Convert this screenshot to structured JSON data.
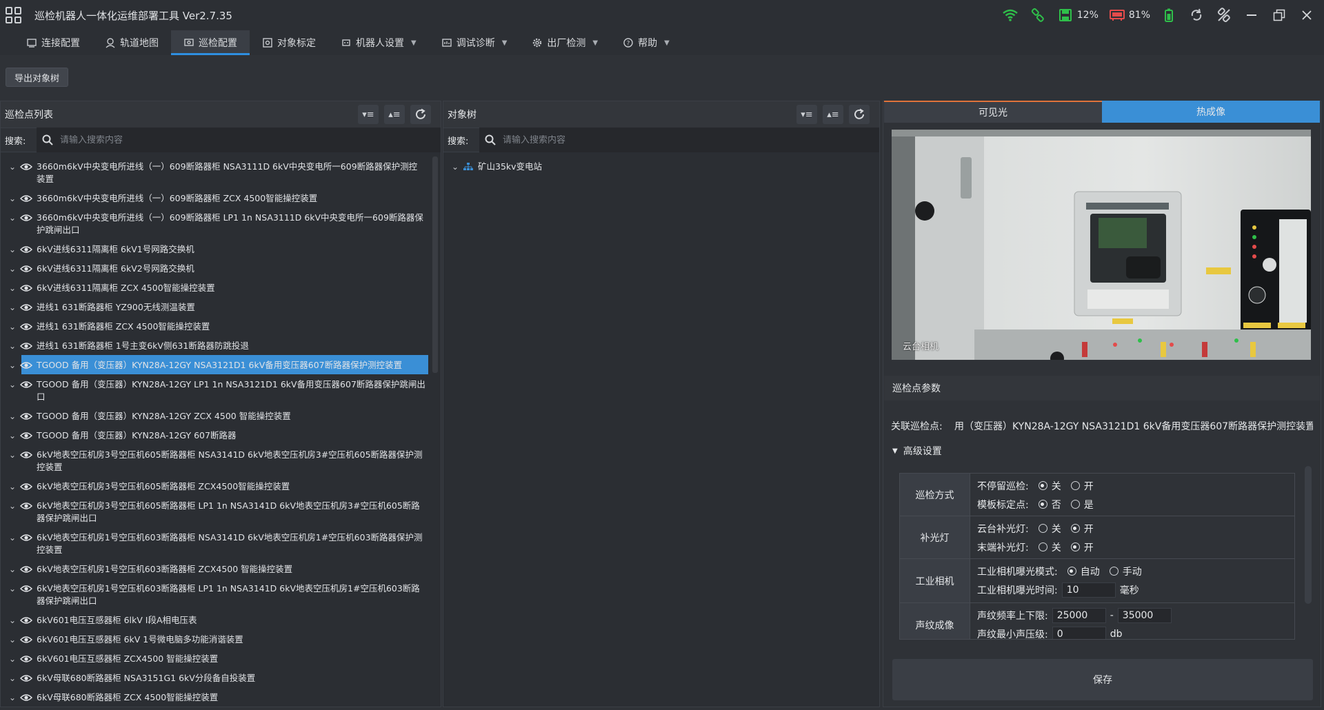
{
  "app": {
    "title": "巡检机器人一体化运维部署工具 Ver2.7.35",
    "wifi_pct": "12%",
    "battery_pct": "81%"
  },
  "menu": [
    {
      "label": "连接配置",
      "icon": "link-icon",
      "dropdown": false
    },
    {
      "label": "轨道地图",
      "icon": "map-icon",
      "dropdown": false
    },
    {
      "label": "巡检配置",
      "icon": "inspection-icon",
      "dropdown": false,
      "active": true
    },
    {
      "label": "对象标定",
      "icon": "target-icon",
      "dropdown": false
    },
    {
      "label": "机器人设置",
      "icon": "robot-icon",
      "dropdown": true
    },
    {
      "label": "调试诊断",
      "icon": "debug-icon",
      "dropdown": true
    },
    {
      "label": "出厂检测",
      "icon": "gear-icon",
      "dropdown": true
    },
    {
      "label": "帮助",
      "icon": "help-icon",
      "dropdown": true
    }
  ],
  "toolbar": {
    "export_label": "导出对象树"
  },
  "left_panel": {
    "title": "巡检点列表",
    "search_label": "搜索:",
    "search_placeholder": "请输入搜索内容",
    "items": [
      "3660m6kV中央变电所进线（一）609断路器柜 NSA3111D 6kV中央变电所一609断路器保护测控装置",
      "3660m6kV中央变电所进线（一）609断路器柜 ZCX 4500智能操控装置",
      "3660m6kV中央变电所进线（一）609断路器柜 LP1 1n NSA3111D 6kV中央变电所一609断路器保护跳闸出口",
      "6kV进线6311隔离柜 6kV1号网路交换机",
      "6kV进线6311隔离柜 6kV2号网路交换机",
      "6kV进线6311隔离柜 ZCX 4500智能操控装置",
      "进线1 631断路器柜 YZ900无线测温装置",
      "进线1 631断路器柜 ZCX 4500智能操控装置",
      "进线1 631断路器柜 1号主变6kV侧631断路器防跳投退",
      "TGOOD 备用（变压器）KYN28A-12GY NSA3121D1 6kV备用变压器607断路器保护测控装置",
      "TGOOD 备用（变压器）KYN28A-12GY LP1 1n NSA3121D1 6kV备用变压器607断路器保护跳闸出口",
      "TGOOD 备用（变压器）KYN28A-12GY ZCX 4500 智能操控装置",
      "TGOOD 备用（变压器）KYN28A-12GY 607断路器",
      "6kV地表空压机房3号空压机605断路器柜 NSA3141D 6kV地表空压机房3#空压机605断路器保护测控装置",
      "6kV地表空压机房3号空压机605断路器柜 ZCX4500智能操控装置",
      "6kV地表空压机房3号空压机605断路器柜 LP1 1n NSA3141D 6kV地表空压机房3#空压机605断路器保护跳闸出口",
      "6kV地表空压机房1号空压机603断路器柜 NSA3141D 6kV地表空压机房1#空压机603断路器保护测控装置",
      "6kV地表空压机房1号空压机603断路器柜 ZCX4500 智能操控装置",
      "6kV地表空压机房1号空压机603断路器柜 LP1 1n NSA3141D 6kV地表空压机房1#空压机603断路器保护跳闸出口",
      "6kV601电压互感器柜 6lkV I段A相电压表",
      "6kV601电压互感器柜 6kV 1号微电脑多功能消谐装置",
      "6kV601电压互感器柜 ZCX4500 智能操控装置",
      "6kV母联680断路器柜 NSA3151G1 6kV分段备自投装置",
      "6kV母联680断路器柜 ZCX 4500智能操控装置",
      "6kV母联680断路器柜 LP1 1n NSA3151G1 6kV分段680断路器保护跳闸出口"
    ],
    "selected_index": 9
  },
  "middle_panel": {
    "title": "对象树",
    "search_label": "搜索:",
    "search_placeholder": "请输入搜索内容",
    "root": "矿山35kv变电站"
  },
  "right_panel": {
    "tab_visible": "可见光",
    "tab_thermal": "热成像",
    "video_caption": "云台相机",
    "params_title": "巡检点参数",
    "assoc_label": "关联巡检点:",
    "assoc_value": "用（变压器）KYN28A-12GY NSA3121D1 6kV备用变压器607断路器保护测控装置",
    "advanced_label": "高级设置",
    "groups": {
      "mode": {
        "label": "巡检方式",
        "nonstop_label": "不停留巡检:",
        "nonstop_off": "关",
        "nonstop_on": "开",
        "template_label": "模板标定点:",
        "template_no": "否",
        "template_yes": "是"
      },
      "light": {
        "label": "补光灯",
        "ptz_label": "云台补光灯:",
        "ptz_off": "关",
        "ptz_on": "开",
        "end_label": "末端补光灯:",
        "end_off": "关",
        "end_on": "开"
      },
      "camera": {
        "label": "工业相机",
        "mode_label": "工业相机曝光模式:",
        "auto": "自动",
        "manual": "手动",
        "time_label": "工业相机曝光时间:",
        "time_value": "10",
        "time_unit": "毫秒"
      },
      "sound": {
        "label": "声纹成像",
        "freq_label": "声纹频率上下限:",
        "freq_low": "25000",
        "dash": "-",
        "freq_high": "35000",
        "min_label": "声纹最小声压级:",
        "min_value": "0",
        "min_unit": "db"
      }
    },
    "save_label": "保存"
  }
}
